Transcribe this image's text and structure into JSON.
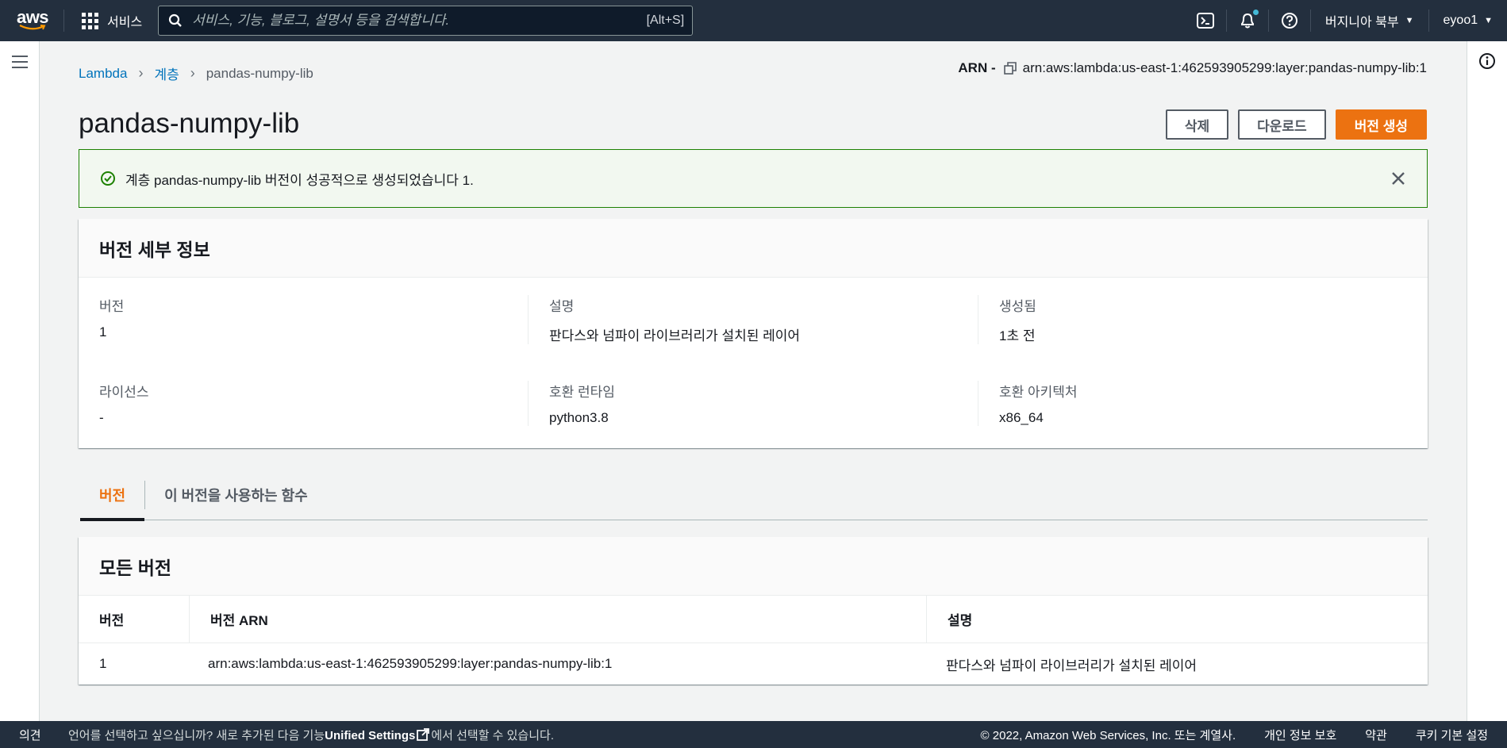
{
  "nav": {
    "logo": "aws",
    "services_label": "서비스",
    "search_placeholder": "서비스, 기능, 블로그, 설명서 등을 검색합니다.",
    "search_shortcut": "[Alt+S]",
    "region": "버지니아 북부",
    "account": "eyoo1"
  },
  "breadcrumb": {
    "items": [
      "Lambda",
      "계층",
      "pandas-numpy-lib"
    ]
  },
  "arn": {
    "label": "ARN -",
    "value": "arn:aws:lambda:us-east-1:462593905299:layer:pandas-numpy-lib:1"
  },
  "page": {
    "title": "pandas-numpy-lib",
    "buttons": {
      "delete": "삭제",
      "download": "다운로드",
      "create_version": "버전 생성"
    }
  },
  "flash": {
    "message": "계층 pandas-numpy-lib 버전이 성공적으로 생성되었습니다 1."
  },
  "details": {
    "title": "버전 세부 정보",
    "fields": [
      {
        "label": "버전",
        "value": "1"
      },
      {
        "label": "설명",
        "value": "판다스와 넘파이 라이브러리가 설치된 레이어"
      },
      {
        "label": "생성됨",
        "value": "1초 전"
      },
      {
        "label": "라이선스",
        "value": "-"
      },
      {
        "label": "호환 런타임",
        "value": "python3.8"
      },
      {
        "label": "호환 아키텍처",
        "value": "x86_64"
      }
    ]
  },
  "tabs": [
    {
      "label": "버전",
      "active": true
    },
    {
      "label": "이 버전을 사용하는 함수",
      "active": false
    }
  ],
  "versions": {
    "title": "모든 버전",
    "columns": [
      "버전",
      "버전 ARN",
      "설명"
    ],
    "rows": [
      [
        "1",
        "arn:aws:lambda:us-east-1:462593905299:layer:pandas-numpy-lib:1",
        "판다스와 넘파이 라이브러리가 설치된 레이어"
      ]
    ]
  },
  "footer": {
    "feedback": "의견",
    "message_pre": "언어를 선택하고 싶으십니까? 새로 추가된 다음 기능",
    "message_link": "Unified Settings",
    "message_post": "에서 선택할 수 있습니다.",
    "copyright": "© 2022, Amazon Web Services, Inc. 또는 계열사.",
    "privacy": "개인 정보 보호",
    "terms": "약관",
    "cookie": "쿠키 기본 설정"
  },
  "colors": {
    "nav_bg": "#232f3e",
    "primary": "#ec7211",
    "link": "#0073bb",
    "success": "#1d8102"
  }
}
